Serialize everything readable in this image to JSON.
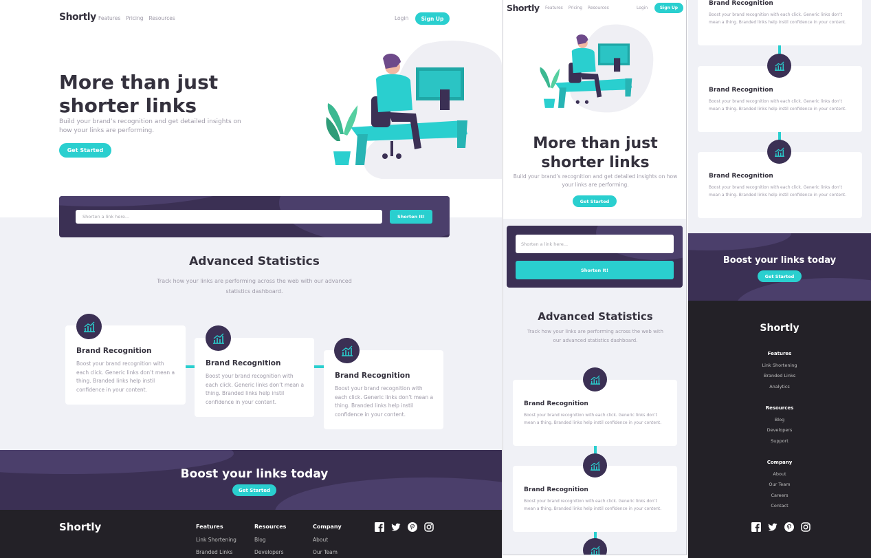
{
  "brand": "Shortly",
  "nav": {
    "features": "Features",
    "pricing": "Pricing",
    "resources": "Resources",
    "login": "Login",
    "signup": "Sign Up"
  },
  "hero": {
    "title_line1": "More than just",
    "title_line2": "shorter links",
    "subtitle": "Build your brand’s recognition and get detailed insights on how your links are performing.",
    "cta": "Get Started"
  },
  "shorten": {
    "placeholder": "Shorten a link here...",
    "button": "Shorten It!"
  },
  "stats": {
    "title": "Advanced Statistics",
    "subtitle": "Track how your links are performing across the web with our advanced statistics dashboard.",
    "cards": [
      {
        "title": "Brand Recognition",
        "text": "Boost your brand recognition with each click. Generic links don’t mean a thing. Branded links help instil confidence in your content."
      },
      {
        "title": "Brand Recognition",
        "text": "Boost your brand recognition with each click. Generic links don’t mean a thing. Branded links help instil confidence in your content."
      },
      {
        "title": "Brand Recognition",
        "text": "Boost your brand recognition with each click. Generic links don’t mean a thing. Branded links help instil confidence in your content."
      }
    ]
  },
  "boost": {
    "title": "Boost your links today",
    "cta": "Get Started"
  },
  "footer": {
    "features": {
      "heading": "Features",
      "links": [
        "Link Shortening",
        "Branded Links",
        "Analytics"
      ]
    },
    "resources": {
      "heading": "Resources",
      "links": [
        "Blog",
        "Developers",
        "Support"
      ]
    },
    "company": {
      "heading": "Company",
      "links": [
        "About",
        "Our Team",
        "Careers",
        "Contact"
      ]
    },
    "social": [
      "facebook-icon",
      "twitter-icon",
      "pinterest-icon",
      "instagram-icon"
    ]
  },
  "colors": {
    "cyan": "#2acfcf",
    "dark_violet": "#3b3054",
    "very_dark": "#232127",
    "grey": "#9e9aa8",
    "bg": "#f0f1f6"
  }
}
